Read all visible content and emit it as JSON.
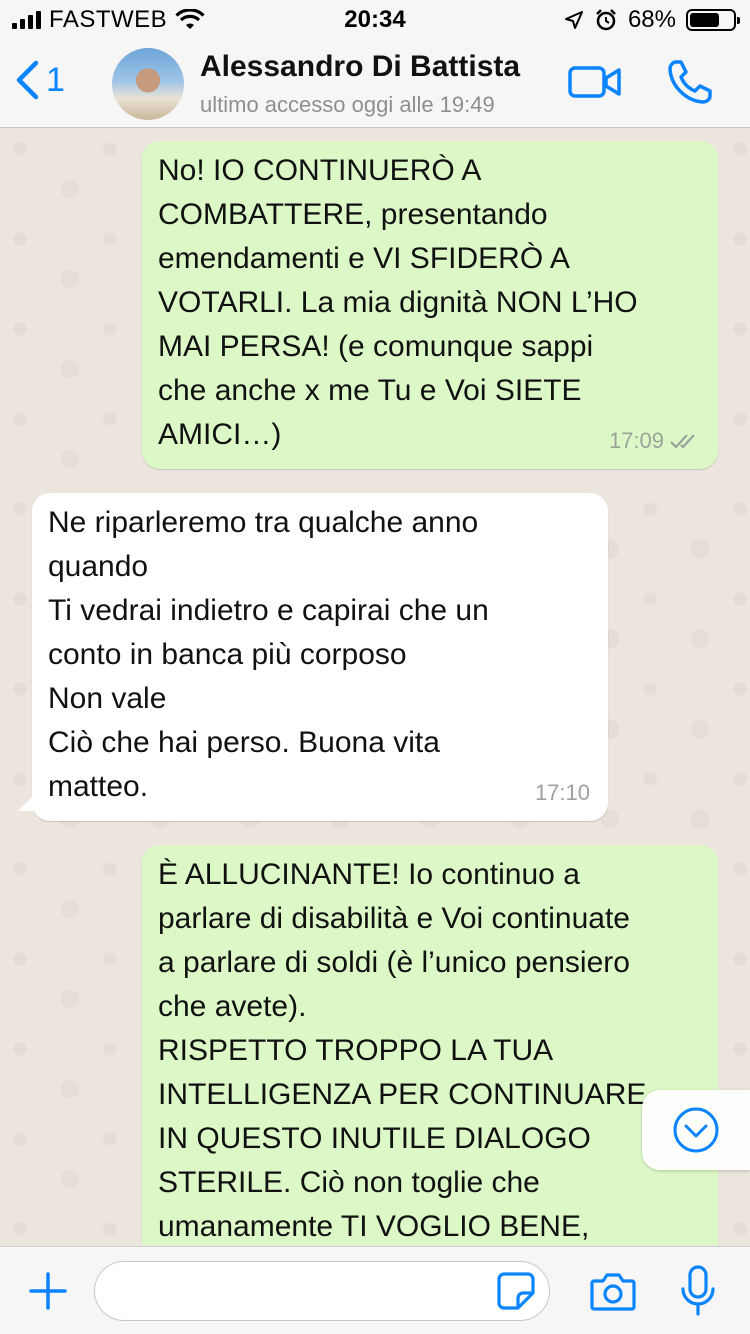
{
  "status_bar": {
    "carrier": "FASTWEB",
    "time": "20:34",
    "battery": "68%",
    "battery_level": 0.68
  },
  "header": {
    "back_count": "1",
    "contact_name": "Alessandro Di Battista",
    "last_seen": "ultimo accesso oggi alle 19:49",
    "icons": [
      "chevron-left-icon",
      "video-call-icon",
      "phone-icon"
    ]
  },
  "messages": [
    {
      "direction": "outgoing",
      "text": "No! IO CONTINUERÒ A\nCOMBATTERE, presentando\nemendamenti e VI SFIDERÒ A\nVOTARLI. La mia dignità NON L’HO\nMAI PERSA! (e comunque sappi\nche anche x me Tu e Voi SIETE\nAMICI…)",
      "time": "17:09",
      "status": "read"
    },
    {
      "direction": "incoming",
      "text": "Ne riparleremo tra qualche anno\nquando\nTi vedrai indietro e capirai che un\nconto in banca più corposo\nNon vale\nCiò che hai perso. Buona vita\nmatteo.",
      "time": "17:10"
    },
    {
      "direction": "outgoing",
      "text": "È ALLUCINANTE! Io continuo a\nparlare di disabilità e Voi continuate\na parlare di soldi (è l’unico pensiero\nche avete).\nRISPETTO TROPPO LA TUA\nINTELLIGENZA PER CONTINUARE\nIN QUESTO INUTILE DIALOGO\nSTERILE. Ciò non toglie che\numanamente TI VOGLIO BENE,"
    }
  ],
  "input_bar": {
    "placeholder": "",
    "icons": [
      "plus-icon",
      "sticker-icon",
      "camera-icon",
      "microphone-icon"
    ]
  },
  "colors": {
    "accent": "#0a84ff",
    "outgoing_bubble": "#dcf8c6",
    "incoming_bubble": "#ffffff",
    "chat_background": "#ece5dd"
  }
}
